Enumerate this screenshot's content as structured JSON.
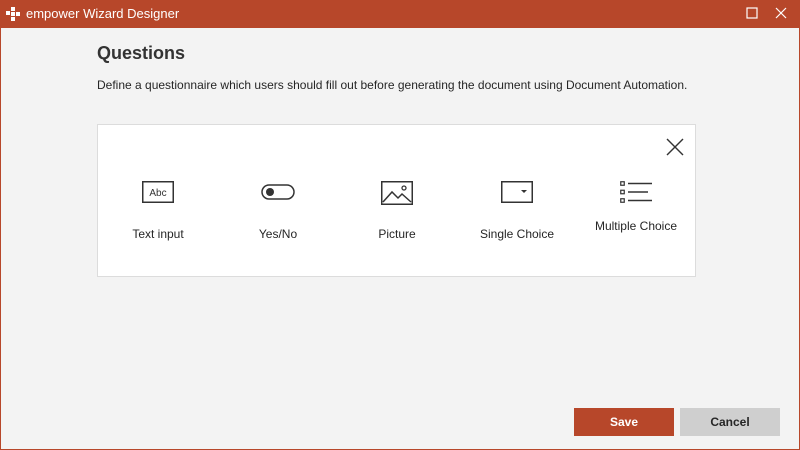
{
  "window": {
    "title": "empower Wizard Designer",
    "app_icon": "empower-logo-icon",
    "maximize_icon": "maximize-icon",
    "close_icon": "close-icon",
    "accent_color": "#b7472a"
  },
  "page": {
    "heading": "Questions",
    "description": "Define a questionnaire which users should fill out before generating the document using Document Automation."
  },
  "panel": {
    "close_icon": "close-icon",
    "question_types": [
      {
        "label": "Text input",
        "icon": "text-input-icon"
      },
      {
        "label": "Yes/No",
        "icon": "toggle-icon"
      },
      {
        "label": "Picture",
        "icon": "picture-icon"
      },
      {
        "label": "Single Choice",
        "icon": "dropdown-icon"
      },
      {
        "label": "Multiple Choice",
        "icon": "checklist-icon"
      }
    ]
  },
  "footer": {
    "save_label": "Save",
    "cancel_label": "Cancel"
  }
}
